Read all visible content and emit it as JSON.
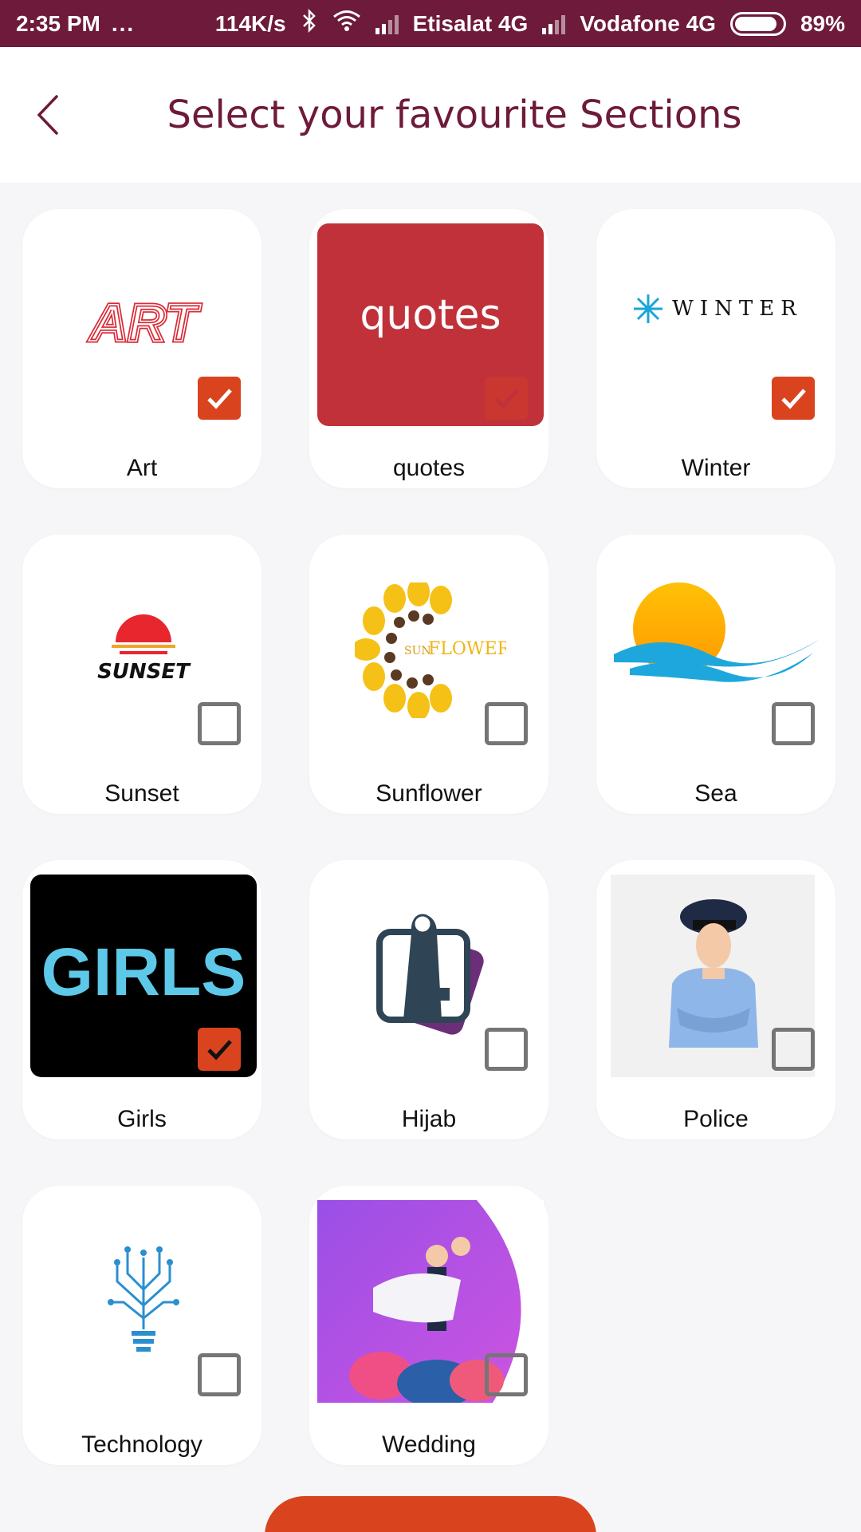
{
  "status_bar": {
    "time": "2:35 PM",
    "dots": "...",
    "speed": "114K/s",
    "carrier1": "Etisalat 4G",
    "carrier2": "Vodafone 4G",
    "battery": "89%",
    "battery_level": 0.89
  },
  "header": {
    "title": "Select your favourite Sections",
    "back_icon": "chevron-left-icon"
  },
  "sections": [
    {
      "label": "Art",
      "checked": true,
      "image_text": "ART"
    },
    {
      "label": "quotes",
      "checked": true,
      "image_text": "quotes"
    },
    {
      "label": "Winter",
      "checked": true,
      "image_text": "WINTER"
    },
    {
      "label": "Sunset",
      "checked": false,
      "image_text": "SUNSET"
    },
    {
      "label": "Sunflower",
      "checked": false,
      "image_text_a": "SUN",
      "image_text_b": "FLOWER"
    },
    {
      "label": "Sea",
      "checked": false
    },
    {
      "label": "Girls",
      "checked": true,
      "image_text": "GIRLS"
    },
    {
      "label": "Hijab",
      "checked": false
    },
    {
      "label": "Police",
      "checked": false
    },
    {
      "label": "Technology",
      "checked": false
    },
    {
      "label": "Wedding",
      "checked": false
    }
  ],
  "colors": {
    "accent": "#d9441f",
    "header_text": "#6e1a3a",
    "status_bar": "#6e1a3a",
    "quotes_bg": "#c0313a",
    "girls_text": "#5ec8e8"
  }
}
